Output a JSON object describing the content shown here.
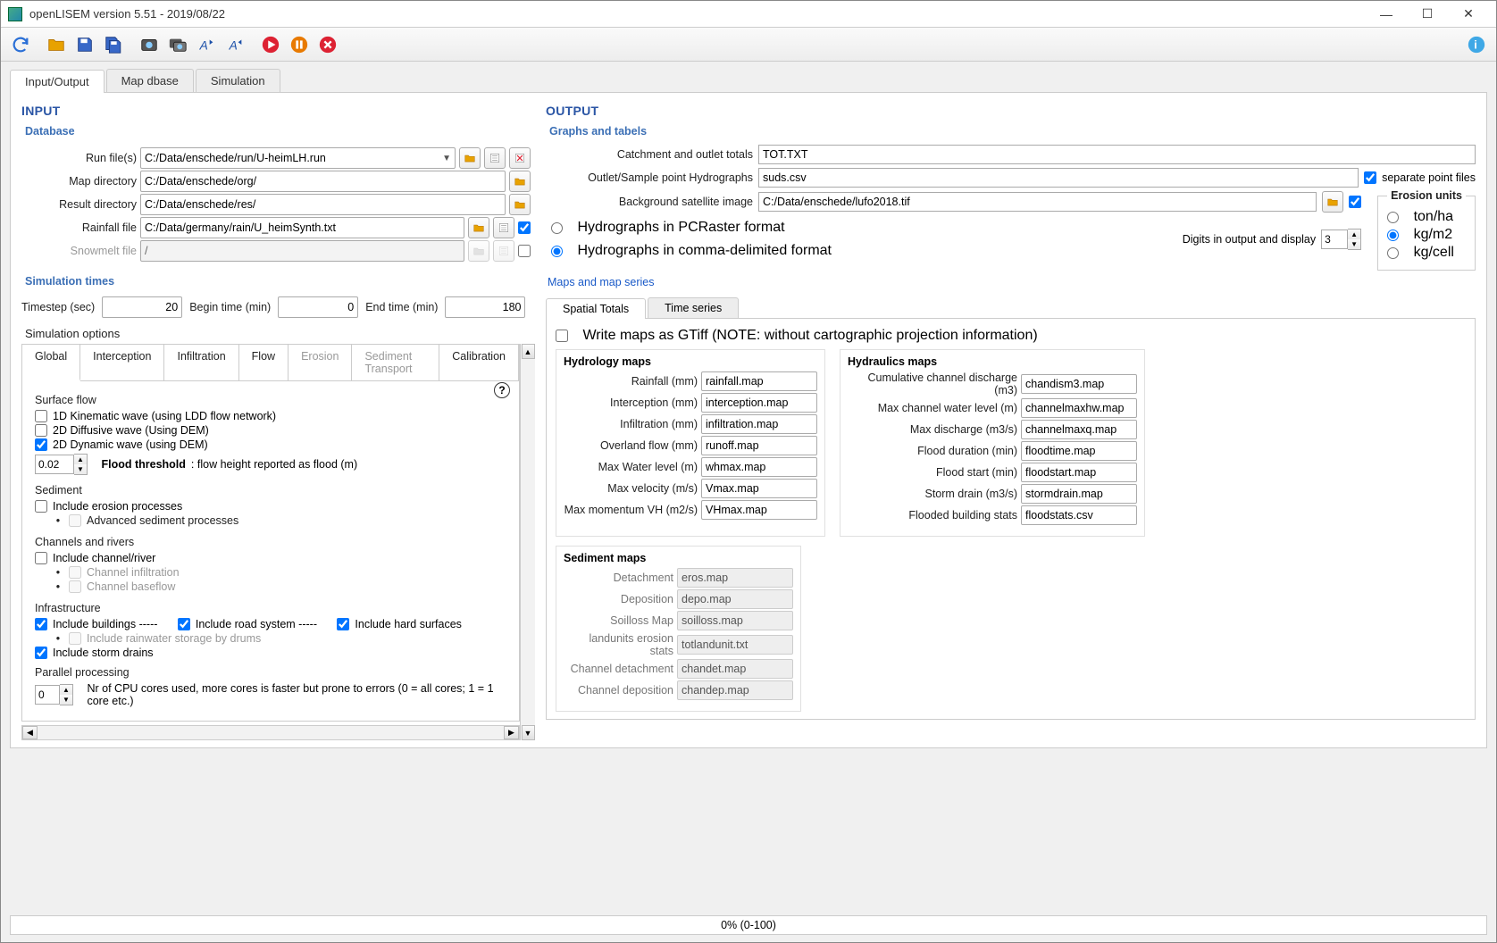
{
  "window": {
    "title": "openLISEM version 5.51 - 2019/08/22"
  },
  "toolbar_icons": [
    "refresh",
    "open",
    "save",
    "save-as",
    "screenshot",
    "screenshot-multi",
    "chart-a",
    "chart-b",
    "run",
    "pause",
    "stop"
  ],
  "main_tabs": [
    "Input/Output",
    "Map dbase",
    "Simulation"
  ],
  "input_title": "INPUT",
  "output_title": "OUTPUT",
  "db_header": "Database",
  "db": {
    "runfiles_label": "Run file(s)",
    "runfiles_value": "C:/Data/enschede/run/U-heimLH.run",
    "mapdir_label": "Map directory",
    "mapdir_value": "C:/Data/enschede/org/",
    "resultdir_label": "Result directory",
    "resultdir_value": "C:/Data/enschede/res/",
    "rainfall_label": "Rainfall file",
    "rainfall_value": "C:/Data/germany/rain/U_heimSynth.txt",
    "snowmelt_label": "Snowmelt file",
    "snowmelt_value": "/"
  },
  "simtimes_header": "Simulation times",
  "simtimes": {
    "timestep_label": "Timestep (sec)",
    "timestep_value": "20",
    "begin_label": "Begin time (min)",
    "begin_value": "0",
    "end_label": "End time (min)",
    "end_value": "180"
  },
  "simopts_title": "Simulation options",
  "opt_tabs": [
    "Global",
    "Interception",
    "Infiltration",
    "Flow",
    "Erosion",
    "Sediment Transport",
    "Calibration"
  ],
  "global": {
    "surface_flow": "Surface flow",
    "kw": "1D Kinematic wave (using LDD flow network)",
    "diff": "2D Diffusive wave (Using DEM)",
    "dyn": "2D Dynamic wave (using DEM)",
    "flood_threshold_value": "0.02",
    "flood_threshold_label": "Flood threshold",
    "flood_threshold_desc": ": flow height reported as flood (m)",
    "sediment": "Sediment",
    "incl_erosion": "Include erosion processes",
    "adv_sed": "Advanced sediment processes",
    "chanriv": "Channels and rivers",
    "incl_channel": "Include channel/river",
    "chan_infil": "Channel infiltration",
    "chan_base": "Channel baseflow",
    "infra": "Infrastructure",
    "incl_buildings": "Include buildings -----",
    "incl_roads": "Include road system -----",
    "incl_hard": "Include hard surfaces",
    "rain_drums": "Include rainwater storage by drums",
    "incl_storm": "Include storm drains",
    "parallel": "Parallel processing",
    "cores_value": "0",
    "cores_desc": "Nr of CPU cores used, more cores is faster but prone to errors (0 = all cores; 1 = 1 core etc.)"
  },
  "out_graphs_header": "Graphs and tabels",
  "out": {
    "catch_label": "Catchment and outlet totals",
    "catch_value": "TOT.TXT",
    "outlet_label": "Outlet/Sample point Hydrographs",
    "outlet_value": "suds.csv",
    "sep_points": "separate point files",
    "bg_label": "Background satellite image",
    "bg_value": "C:/Data/enschede/lufo2018.tif",
    "pcraster": "Hydrographs in PCRaster format",
    "csv": "Hydrographs in comma-delimited format",
    "digits_label": "Digits in output and display",
    "digits_value": "3"
  },
  "erosion_units": {
    "legend": "Erosion units",
    "tonha": "ton/ha",
    "kgm2": "kg/m2",
    "kgcell": "kg/cell"
  },
  "maps_link": "Maps and map series",
  "maps_tabs": [
    "Spatial Totals",
    "Time series"
  ],
  "gtiff": "Write maps as GTiff (NOTE: without cartographic projection information)",
  "hydrology_title": "Hydrology maps",
  "hydraulics_title": "Hydraulics maps",
  "sediment_title": "Sediment maps",
  "hydrology": [
    {
      "l": "Rainfall (mm)",
      "v": "rainfall.map"
    },
    {
      "l": "Interception (mm)",
      "v": "interception.map"
    },
    {
      "l": "Infiltration (mm)",
      "v": "infiltration.map"
    },
    {
      "l": "Overland flow (mm)",
      "v": "runoff.map"
    },
    {
      "l": "Max Water level  (m)",
      "v": "whmax.map"
    },
    {
      "l": "Max velocity (m/s)",
      "v": "Vmax.map"
    },
    {
      "l": "Max momentum VH (m2/s)",
      "v": "VHmax.map"
    }
  ],
  "hydraulics": [
    {
      "l": "Cumulative channel discharge (m3)",
      "v": "chandism3.map"
    },
    {
      "l": "Max channel water level (m)",
      "v": "channelmaxhw.map"
    },
    {
      "l": "Max discharge (m3/s)",
      "v": "channelmaxq.map"
    },
    {
      "l": "Flood duration (min)",
      "v": "floodtime.map"
    },
    {
      "l": "Flood start (min)",
      "v": "floodstart.map"
    },
    {
      "l": "Storm drain (m3/s)",
      "v": "stormdrain.map"
    },
    {
      "l": "Flooded building stats",
      "v": "floodstats.csv"
    }
  ],
  "sediment": [
    {
      "l": "Detachment",
      "v": "eros.map"
    },
    {
      "l": "Deposition",
      "v": "depo.map"
    },
    {
      "l": "Soilloss Map",
      "v": "soilloss.map"
    },
    {
      "l": "landunits erosion stats",
      "v": "totlandunit.txt"
    },
    {
      "l": "Channel detachment",
      "v": "chandet.map"
    },
    {
      "l": "Channel deposition",
      "v": "chandep.map"
    }
  ],
  "status": "0% (0-100)"
}
